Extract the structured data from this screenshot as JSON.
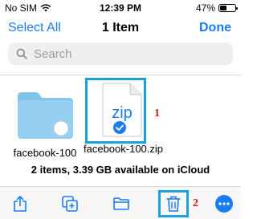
{
  "status_bar": {
    "carrier": "No SIM",
    "time": "12:39 PM",
    "battery_text": "47%",
    "battery_level": 0.47
  },
  "nav": {
    "select_all": "Select All",
    "title": "1 Item",
    "done": "Done"
  },
  "search": {
    "placeholder": "Search"
  },
  "files": [
    {
      "name": "facebook-100",
      "kind": "folder-icon"
    },
    {
      "name": "facebook-100.zip",
      "kind": "zip-file-icon",
      "icon_text": "zip",
      "selected": true
    }
  ],
  "annotations": {
    "file_marker": "1",
    "delete_marker": "2"
  },
  "storage": {
    "text": "2 items, 3.39 GB available on iCloud"
  },
  "toolbar": {
    "items": [
      "share-icon",
      "duplicate-icon",
      "move-folder-icon",
      "trash-icon",
      "more-icon"
    ]
  },
  "colors": {
    "accent": "#1a7cf2",
    "folder": "#8ccaf0",
    "highlight_box": "#1aa3d9",
    "annotation": "#d01818"
  }
}
